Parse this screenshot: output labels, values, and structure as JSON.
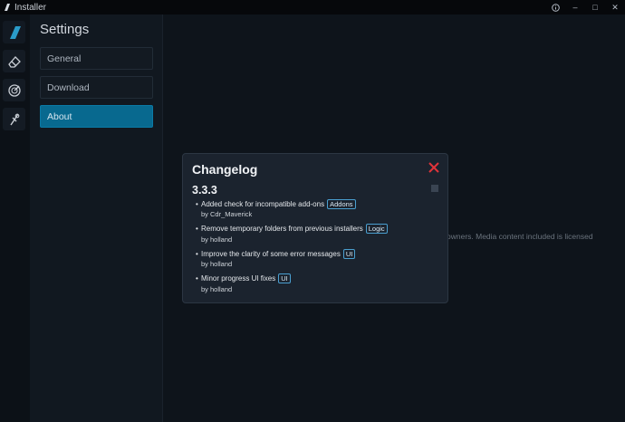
{
  "window": {
    "title": "Installer",
    "controls": {
      "info_icon": "info-icon",
      "minimize": "–",
      "maximize": "□",
      "close": "✕"
    }
  },
  "rail": {
    "icons": [
      "aircraft-tail-icon",
      "eraser-icon",
      "radar-icon",
      "tool-icon"
    ]
  },
  "settings": {
    "heading": "Settings",
    "items": [
      {
        "label": "General",
        "active": false
      },
      {
        "label": "Download",
        "active": false
      },
      {
        "label": "About",
        "active": true
      }
    ]
  },
  "background": {
    "text": "owners. Media content included is licensed"
  },
  "modal": {
    "title": "Changelog",
    "version": "3.3.3",
    "entries": [
      {
        "text": "Added check for incompatible add-ons",
        "tag": "Addons",
        "author": "by Cdr_Maverick"
      },
      {
        "text": "Remove temporary folders from previous installers",
        "tag": "Logic",
        "author": "by holland"
      },
      {
        "text": "Improve the clarity of some error messages",
        "tag": "UI",
        "author": "by holland"
      },
      {
        "text": "Minor progress UI fixes",
        "tag": "UI",
        "author": "by holland"
      }
    ]
  },
  "colors": {
    "accent": "#08698f",
    "close_red": "#e0343a",
    "tag_border": "#4a9fd0"
  }
}
